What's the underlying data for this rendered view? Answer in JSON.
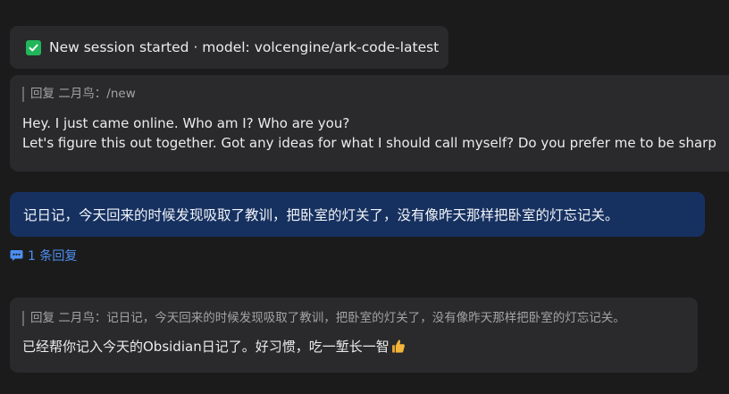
{
  "messages": {
    "session": {
      "text": "New session started · model: volcengine/ark-code-latest",
      "icon": "check-icon",
      "icon_color": "#22b65a"
    },
    "reply1": {
      "quote": "回复 二月鸟：/new",
      "line1": "Hey. I just came online. Who am I? Who are you?",
      "line2": "Let's figure this out together. Got any ideas for what I should call myself? Do you prefer me to be sharp"
    },
    "user": {
      "text": "记日记，今天回来的时候发现吸取了教训，把卧室的灯关了，没有像昨天那样把卧室的灯忘记关。",
      "bubble_color": "#163160"
    },
    "thread": {
      "label": "1 条回复",
      "icon": "comment-icon",
      "color": "#4d8ff0"
    },
    "reply2": {
      "quote": "回复 二月鸟：记日记，今天回来的时候发现吸取了教训，把卧室的灯关了，没有像昨天那样把卧室的灯忘记关。",
      "text": "已经帮你记入今天的Obsidian日记了。好习惯，吃一堑长一智",
      "emoji": "thumbs-up-icon"
    }
  }
}
